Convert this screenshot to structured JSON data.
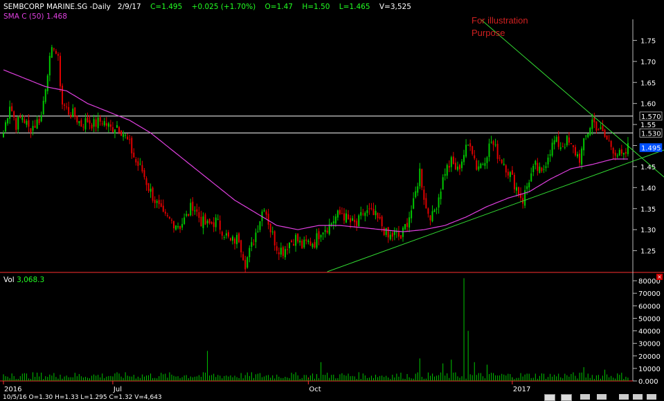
{
  "header": {
    "symbol": "SEMBCORP MARINE.SG -Daily",
    "date": "2/9/17",
    "close": "C=1.495",
    "change": "+0.025 (+1.70%)",
    "open": "O=1.47",
    "high": "H=1.50",
    "low": "L=1.465",
    "volume": "V=3,525",
    "sma_label": "SMA C (50)",
    "sma_value": "1.468"
  },
  "annotation": [
    "For illustration",
    "Purpose"
  ],
  "volume_panel": {
    "label": "Vol",
    "value": "3,068.3"
  },
  "price_labels": {
    "resistance_high": "1.570",
    "resistance_low": "1.530",
    "last": "1.495"
  },
  "footer": {
    "crosshair_text": "10/5/16   O=1.30   H=1.33   L=1.295   C=1.32   V=4,643"
  },
  "colors": {
    "up": "#00c800",
    "down": "#e00000",
    "sma": "#e040e0",
    "trend": "#33dd33",
    "hline": "#ffffff",
    "annotation": "#d02020",
    "last_bg": "#0050ff"
  },
  "chart_data": [
    {
      "type": "candlestick",
      "title": "SEMBCORP MARINE.SG -Daily",
      "x_ticks": [
        "2016",
        "Jul",
        "Oct",
        "2017"
      ],
      "ylim": [
        1.2,
        1.8
      ],
      "y_ticks": [
        "1.25",
        "1.30",
        "1.35",
        "1.40",
        "1.45",
        "1.50",
        "1.55",
        "1.60",
        "1.65",
        "1.70",
        "1.75"
      ],
      "horizontal_lines": [
        1.57,
        1.53
      ],
      "close_anchors": [
        [
          0,
          1.53
        ],
        [
          3,
          1.6
        ],
        [
          6,
          1.55
        ],
        [
          9,
          1.57
        ],
        [
          12,
          1.54
        ],
        [
          15,
          1.55
        ],
        [
          18,
          1.57
        ],
        [
          21,
          1.68
        ],
        [
          24,
          1.74
        ],
        [
          26,
          1.7
        ],
        [
          28,
          1.6
        ],
        [
          31,
          1.58
        ],
        [
          34,
          1.57
        ],
        [
          37,
          1.55
        ],
        [
          40,
          1.56
        ],
        [
          43,
          1.55
        ],
        [
          47,
          1.56
        ],
        [
          51,
          1.54
        ],
        [
          54,
          1.55
        ],
        [
          57,
          1.53
        ],
        [
          60,
          1.5
        ],
        [
          63,
          1.46
        ],
        [
          66,
          1.44
        ],
        [
          69,
          1.4
        ],
        [
          72,
          1.37
        ],
        [
          76,
          1.33
        ],
        [
          80,
          1.32
        ],
        [
          84,
          1.31
        ],
        [
          87,
          1.33
        ],
        [
          90,
          1.36
        ],
        [
          94,
          1.32
        ],
        [
          97,
          1.31
        ],
        [
          101,
          1.32
        ],
        [
          104,
          1.3
        ],
        [
          108,
          1.27
        ],
        [
          112,
          1.28
        ],
        [
          115,
          1.22
        ],
        [
          118,
          1.26
        ],
        [
          121,
          1.31
        ],
        [
          124,
          1.36
        ],
        [
          127,
          1.3
        ],
        [
          130,
          1.26
        ],
        [
          133,
          1.25
        ],
        [
          136,
          1.27
        ],
        [
          139,
          1.28
        ],
        [
          142,
          1.26
        ],
        [
          145,
          1.27
        ],
        [
          148,
          1.27
        ],
        [
          151,
          1.3
        ],
        [
          155,
          1.31
        ],
        [
          158,
          1.33
        ],
        [
          161,
          1.34
        ],
        [
          164,
          1.32
        ],
        [
          168,
          1.31
        ],
        [
          171,
          1.34
        ],
        [
          174,
          1.34
        ],
        [
          177,
          1.33
        ],
        [
          180,
          1.31
        ],
        [
          183,
          1.28
        ],
        [
          186,
          1.29
        ],
        [
          189,
          1.28
        ],
        [
          192,
          1.32
        ],
        [
          195,
          1.36
        ],
        [
          198,
          1.44
        ],
        [
          201,
          1.35
        ],
        [
          204,
          1.33
        ],
        [
          207,
          1.38
        ],
        [
          210,
          1.44
        ],
        [
          213,
          1.46
        ],
        [
          216,
          1.44
        ],
        [
          219,
          1.48
        ],
        [
          222,
          1.51
        ],
        [
          225,
          1.45
        ],
        [
          228,
          1.46
        ],
        [
          232,
          1.51
        ],
        [
          235,
          1.48
        ],
        [
          238,
          1.46
        ],
        [
          241,
          1.43
        ],
        [
          244,
          1.4
        ],
        [
          247,
          1.37
        ],
        [
          250,
          1.42
        ],
        [
          253,
          1.45
        ],
        [
          256,
          1.43
        ],
        [
          259,
          1.48
        ],
        [
          262,
          1.51
        ],
        [
          265,
          1.5
        ],
        [
          268,
          1.51
        ],
        [
          271,
          1.49
        ],
        [
          274,
          1.47
        ],
        [
          277,
          1.52
        ],
        [
          280,
          1.56
        ],
        [
          283,
          1.54
        ],
        [
          286,
          1.52
        ],
        [
          289,
          1.5
        ],
        [
          292,
          1.48
        ],
        [
          295,
          1.47
        ],
        [
          297,
          1.495
        ]
      ],
      "sma_anchors": [
        [
          0,
          1.68
        ],
        [
          10,
          1.66
        ],
        [
          20,
          1.64
        ],
        [
          30,
          1.63
        ],
        [
          40,
          1.6
        ],
        [
          50,
          1.58
        ],
        [
          60,
          1.56
        ],
        [
          70,
          1.53
        ],
        [
          80,
          1.49
        ],
        [
          90,
          1.45
        ],
        [
          100,
          1.41
        ],
        [
          110,
          1.37
        ],
        [
          120,
          1.34
        ],
        [
          130,
          1.31
        ],
        [
          140,
          1.3
        ],
        [
          150,
          1.31
        ],
        [
          160,
          1.31
        ],
        [
          170,
          1.305
        ],
        [
          180,
          1.3
        ],
        [
          190,
          1.295
        ],
        [
          200,
          1.3
        ],
        [
          210,
          1.31
        ],
        [
          220,
          1.33
        ],
        [
          230,
          1.355
        ],
        [
          240,
          1.375
        ],
        [
          250,
          1.39
        ],
        [
          260,
          1.42
        ],
        [
          270,
          1.445
        ],
        [
          280,
          1.455
        ],
        [
          290,
          1.468
        ],
        [
          297,
          1.468
        ]
      ],
      "trendlines": [
        {
          "from": [
            154,
            1.2
          ],
          "to": [
            320,
            1.5
          ]
        },
        {
          "from": [
            227,
            1.8
          ],
          "to": [
            320,
            1.4
          ]
        }
      ],
      "volume": {
        "ylim": [
          0,
          85000
        ],
        "y_ticks": [
          "0.000",
          "10000",
          "20000",
          "30000",
          "40000",
          "50000",
          "60000",
          "70000",
          "80000"
        ],
        "spikes": [
          [
            4,
            6000
          ],
          [
            27,
            5000
          ],
          [
            97,
            24000
          ],
          [
            151,
            15000
          ],
          [
            198,
            18000
          ],
          [
            209,
            14000
          ],
          [
            213,
            17000
          ],
          [
            219,
            82000
          ],
          [
            221,
            40000
          ],
          [
            224,
            15000
          ],
          [
            230,
            13000
          ],
          [
            276,
            11000
          ],
          [
            286,
            9000
          ]
        ]
      }
    }
  ]
}
